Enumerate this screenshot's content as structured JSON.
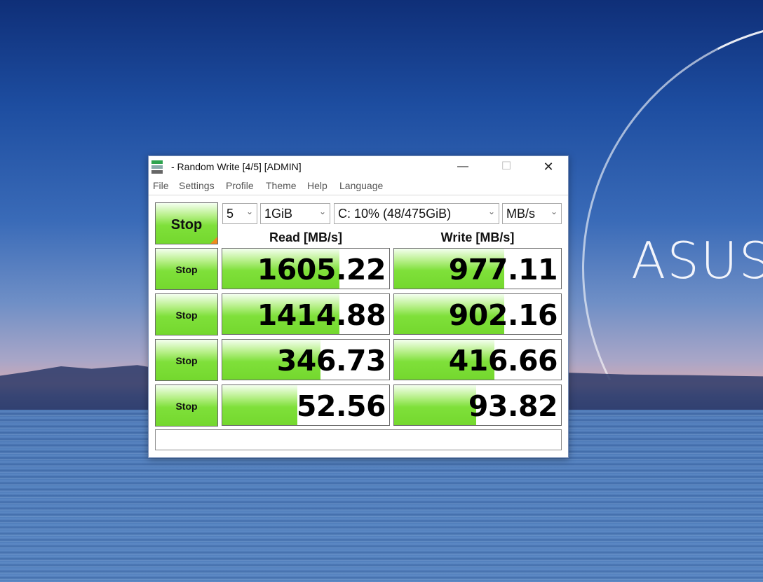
{
  "window": {
    "title": "- Random Write [4/5] [ADMIN]",
    "controls": {
      "minimize": "—",
      "maximize": "☐",
      "close": "✕"
    }
  },
  "menu": [
    "File",
    "Settings",
    "Profile",
    "Theme",
    "Help",
    "Language"
  ],
  "toolbar": {
    "all_button": "Stop",
    "count": "5",
    "size": "1GiB",
    "drive": "C: 10% (48/475GiB)",
    "unit": "MB/s"
  },
  "headers": {
    "read": "Read [MB/s]",
    "write": "Write [MB/s]"
  },
  "rows": [
    {
      "button": "Stop",
      "read": "1605.22",
      "write": "977.11",
      "read_fill": 0.7,
      "write_fill": 0.66
    },
    {
      "button": "Stop",
      "read": "1414.88",
      "write": "902.16",
      "read_fill": 0.7,
      "write_fill": 0.66
    },
    {
      "button": "Stop",
      "read": "346.73",
      "write": "416.66",
      "read_fill": 0.59,
      "write_fill": 0.6
    },
    {
      "button": "Stop",
      "read": "52.56",
      "write": "93.82",
      "read_fill": 0.45,
      "write_fill": 0.49
    }
  ],
  "status": "",
  "desktop": {
    "brand": "ASUS"
  },
  "colors": {
    "accent_green": "#7fe03a",
    "corner_orange": "#f08a1c"
  }
}
